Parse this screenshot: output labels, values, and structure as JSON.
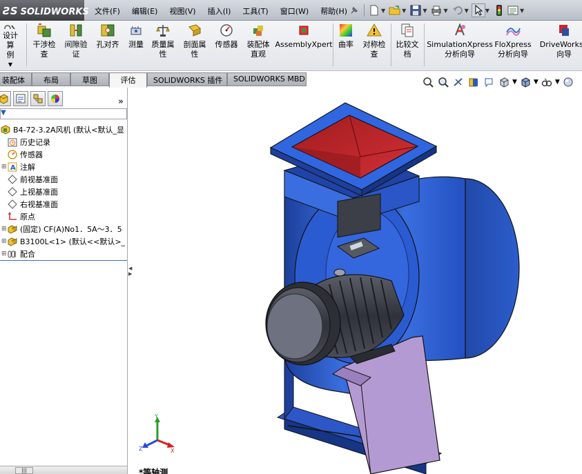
{
  "app": {
    "logo_prefix": "ƧS",
    "logo_text": "SOLIDWORKS"
  },
  "menu": {
    "items": [
      "文件(F)",
      "编辑(E)",
      "视图(V)",
      "插入(I)",
      "工具(T)",
      "窗口(W)",
      "帮助(H)"
    ]
  },
  "ribbon": {
    "design_calc": [
      "设计算",
      "例"
    ],
    "buttons": [
      {
        "line1": "干涉检",
        "line2": "查",
        "icon": "interference-icon"
      },
      {
        "line1": "间隙验",
        "line2": "证",
        "icon": "clearance-icon"
      },
      {
        "line1": "孔对齐",
        "line2": "",
        "icon": "hole-align-icon"
      },
      {
        "line1": "测量",
        "line2": "",
        "icon": "measure-icon"
      },
      {
        "line1": "质量属",
        "line2": "性",
        "icon": "mass-props-icon"
      },
      {
        "line1": "剖面属",
        "line2": "性",
        "icon": "section-props-icon"
      },
      {
        "line1": "传感器",
        "line2": "",
        "icon": "sensor-icon"
      },
      {
        "line1": "装配体",
        "line2": "直观",
        "icon": "assembly-visual-icon"
      },
      {
        "line1": "AssemblyXpert",
        "line2": "",
        "icon": "assemblyxpert-icon"
      },
      {
        "line1": "曲率",
        "line2": "",
        "icon": "curvature-icon"
      },
      {
        "line1": "对称检",
        "line2": "查",
        "icon": "symmetry-icon"
      },
      {
        "line1": "比较文",
        "line2": "档",
        "icon": "compare-icon"
      },
      {
        "line1": "SimulationXpress",
        "line2": "分析向导",
        "icon": "simulation-icon"
      },
      {
        "line1": "FloXpress",
        "line2": "分析向导",
        "icon": "floxpress-icon"
      },
      {
        "line1": "DriveWorksX",
        "line2": "向导",
        "icon": "driveworks-icon"
      }
    ]
  },
  "tabs": {
    "items": [
      "装配体",
      "布局",
      "草图",
      "评估",
      "SOLIDWORKS 插件",
      "SOLIDWORKS MBD"
    ],
    "active": "评估"
  },
  "tree": {
    "items": [
      {
        "label": "B4-72-3.2A风机  (默认<默认_显",
        "icon": "assembly-icon"
      },
      {
        "label": "历史记录",
        "icon": "history-icon"
      },
      {
        "label": "传感器",
        "icon": "sensor-icon"
      },
      {
        "label": "注解",
        "icon": "annotation-icon"
      },
      {
        "label": "前视基准面",
        "icon": "plane-icon"
      },
      {
        "label": "上视基准面",
        "icon": "plane-icon"
      },
      {
        "label": "右视基准面",
        "icon": "plane-icon"
      },
      {
        "label": "原点",
        "icon": "origin-icon"
      },
      {
        "label": "(固定) CF(A)No1．5A～3．5",
        "icon": "part-icon"
      },
      {
        "label": "B3100L<1>  (默认<<默认>_",
        "icon": "part-icon"
      },
      {
        "label": "配合",
        "icon": "mates-icon"
      }
    ]
  },
  "sidebar": {
    "more_label": "»",
    "filter_icon": "funnel-icon"
  },
  "viewport": {
    "view_name": "*等轴测",
    "triad": {
      "x": "X",
      "y": "Y",
      "z": "Z"
    },
    "colors": {
      "body": "#2f5fd0",
      "inlet": "#c8272b",
      "stand": "#b49ad2",
      "motor": "#3c3f48"
    }
  }
}
